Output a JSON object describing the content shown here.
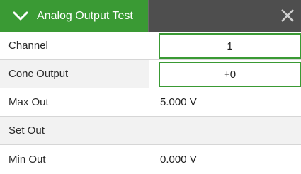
{
  "title": "Analog Output Test",
  "icons": {
    "collapse": "chevron-down-icon",
    "close": "close-icon"
  },
  "colors": {
    "accent_green": "#3a9a34",
    "header_dark": "#4e4e4e"
  },
  "rows": [
    {
      "label": "Channel",
      "value": "1"
    },
    {
      "label": "Conc Output",
      "value": "+0"
    },
    {
      "label": "Max Out",
      "value": "5.000 V"
    },
    {
      "label": "Set Out",
      "value": ""
    },
    {
      "label": "Min Out",
      "value": "0.000 V"
    }
  ]
}
